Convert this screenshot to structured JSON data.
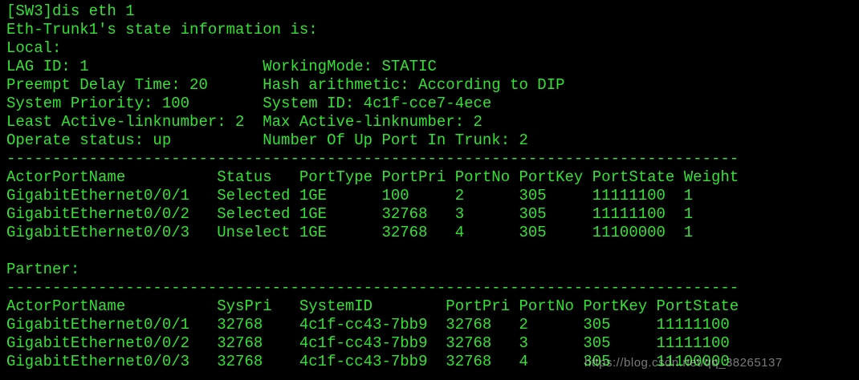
{
  "terminal": {
    "lines": [
      "[SW3]dis eth 1",
      "Eth-Trunk1's state information is:",
      "Local:",
      "LAG ID: 1                   WorkingMode: STATIC",
      "Preempt Delay Time: 20      Hash arithmetic: According to DIP",
      "System Priority: 100        System ID: 4c1f-cce7-4ece",
      "Least Active-linknumber: 2  Max Active-linknumber: 2",
      "Operate status: up          Number Of Up Port In Trunk: 2",
      "--------------------------------------------------------------------------------",
      "ActorPortName          Status   PortType PortPri PortNo PortKey PortState Weight",
      "GigabitEthernet0/0/1   Selected 1GE      100     2      305     11111100  1",
      "GigabitEthernet0/0/2   Selected 1GE      32768   3      305     11111100  1",
      "GigabitEthernet0/0/3   Unselect 1GE      32768   4      305     11100000  1",
      "",
      "Partner:",
      "--------------------------------------------------------------------------------",
      "ActorPortName          SysPri   SystemID        PortPri PortNo PortKey PortState",
      "GigabitEthernet0/0/1   32768    4c1f-cc43-7bb9  32768   2      305     11111100",
      "GigabitEthernet0/0/2   32768    4c1f-cc43-7bb9  32768   3      305     11111100",
      "GigabitEthernet0/0/3   32768    4c1f-cc43-7bb9  32768   4      305     11100000"
    ]
  },
  "watermark": "https://blog.csdn.net/qq_38265137",
  "colors": {
    "background": "#000000",
    "text": "#33e233"
  }
}
